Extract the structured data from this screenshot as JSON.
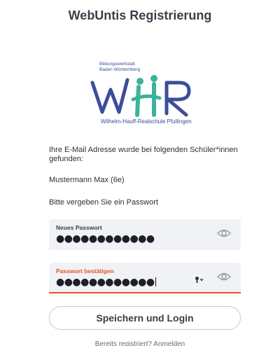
{
  "header": {
    "title": "WebUntis Registrierung"
  },
  "logo": {
    "line1": "Bildungswerkstatt",
    "line2": "Baden Württemberg",
    "letters": "WHR",
    "school_name": "Wilhelm-Hauff-Realschule Pfullingen",
    "colors": {
      "blue": "#3a4e9a",
      "green": "#3bb39a"
    }
  },
  "content": {
    "intro": "Ihre E-Mail Adresse wurde bei folgenden Schüler*innen gefunden:",
    "student": "Mustermann Max (6e)",
    "instruction": "Bitte vergeben Sie ein Passwort"
  },
  "form": {
    "new_password": {
      "label": "Neues Passwort",
      "value": "●●●●●●●●●●●●",
      "icon": "eye-icon"
    },
    "confirm_password": {
      "label": "Passwort bestätigen",
      "value": "●●●●●●●●●●●●",
      "icons": [
        "key-icon",
        "eye-icon"
      ],
      "focused": true
    },
    "submit_label": "Speichern und Login"
  },
  "footer": {
    "text": "Bereits registriert? Anmelden"
  },
  "colors": {
    "accent": "#e8502d",
    "field_bg": "#f1f2f5"
  }
}
